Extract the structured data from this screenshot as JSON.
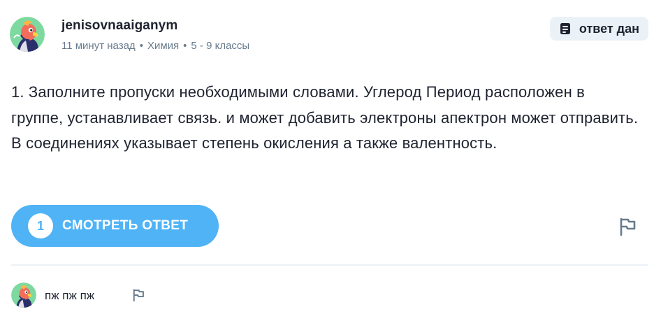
{
  "question": {
    "author": {
      "username": "jenisovnaaiganym",
      "avatar_icon": "parrot-avatar-icon"
    },
    "meta": {
      "time": "11 минут назад",
      "subject": "Химия",
      "grade": "5 - 9 классы",
      "separator": "•"
    },
    "badge": {
      "label": "ответ дан",
      "icon": "document-icon"
    },
    "text": "1. Заполните пропуски необходимыми словами. Углерод Период расположен в группе, устанавливает связь. и может добавить электроны апектрон может отправить. В соединениях указывает степень окисления а также валентность.",
    "answers_button": {
      "count": "1",
      "label": "СМОТРЕТЬ ОТВЕТ"
    },
    "report_icon": "flag-icon"
  },
  "comment": {
    "avatar_icon": "parrot-avatar-icon",
    "text": "пж пж пж",
    "report_icon": "flag-icon"
  },
  "colors": {
    "accent": "#4fb3f6",
    "text": "#1f2330",
    "muted": "#687b8c",
    "badge_bg": "#ebf2f7"
  }
}
